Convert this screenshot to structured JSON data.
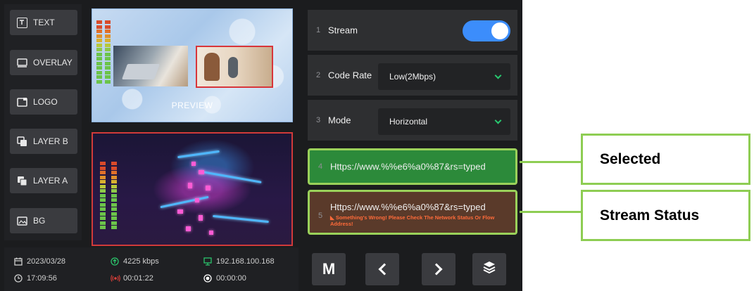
{
  "left_menu": {
    "items": [
      {
        "label": "TEXT",
        "icon": "text-icon"
      },
      {
        "label": "OVERLAY",
        "icon": "overlay-icon"
      },
      {
        "label": "LOGO",
        "icon": "logo-icon"
      },
      {
        "label": "LAYER B",
        "icon": "layer-b-icon"
      },
      {
        "label": "LAYER A",
        "icon": "layer-a-icon"
      },
      {
        "label": "BG",
        "icon": "image-icon"
      }
    ]
  },
  "preview": {
    "label": "PREVIEW"
  },
  "status": {
    "date": "2023/03/28",
    "time": "17:09:56",
    "bitrate": "4225 kbps",
    "duration": "00:01:22",
    "ip": "192.168.100.168",
    "record_time": "00:00:00"
  },
  "settings": {
    "rows": [
      {
        "num": "1",
        "label": "Stream",
        "toggle_on": true
      },
      {
        "num": "2",
        "label": "Code Rate",
        "value": "Low(2Mbps)"
      },
      {
        "num": "3",
        "label": "Mode",
        "value": "Horizontal"
      },
      {
        "num": "4",
        "url": "Https://www.%%e6%a0%87&rs=typed"
      },
      {
        "num": "5",
        "url": "Https://www.%%e6%a0%87&rs=typed",
        "error": "Something's Wrong! Please Check The Network Status Or Flow Address!"
      }
    ]
  },
  "bottom_buttons": [
    {
      "label": "M"
    },
    {
      "icon": "chevron-left-icon"
    },
    {
      "icon": "chevron-right-icon"
    },
    {
      "icon": "layers-icon"
    }
  ],
  "callouts": {
    "selected": "Selected",
    "stream_status": "Stream Status"
  },
  "colors": {
    "accent_green": "#2c8a3a",
    "callout_border": "#8ecd53",
    "toggle_blue": "#3c8dfb",
    "program_border": "#d13a3a",
    "error_text": "#ff6b3a"
  }
}
